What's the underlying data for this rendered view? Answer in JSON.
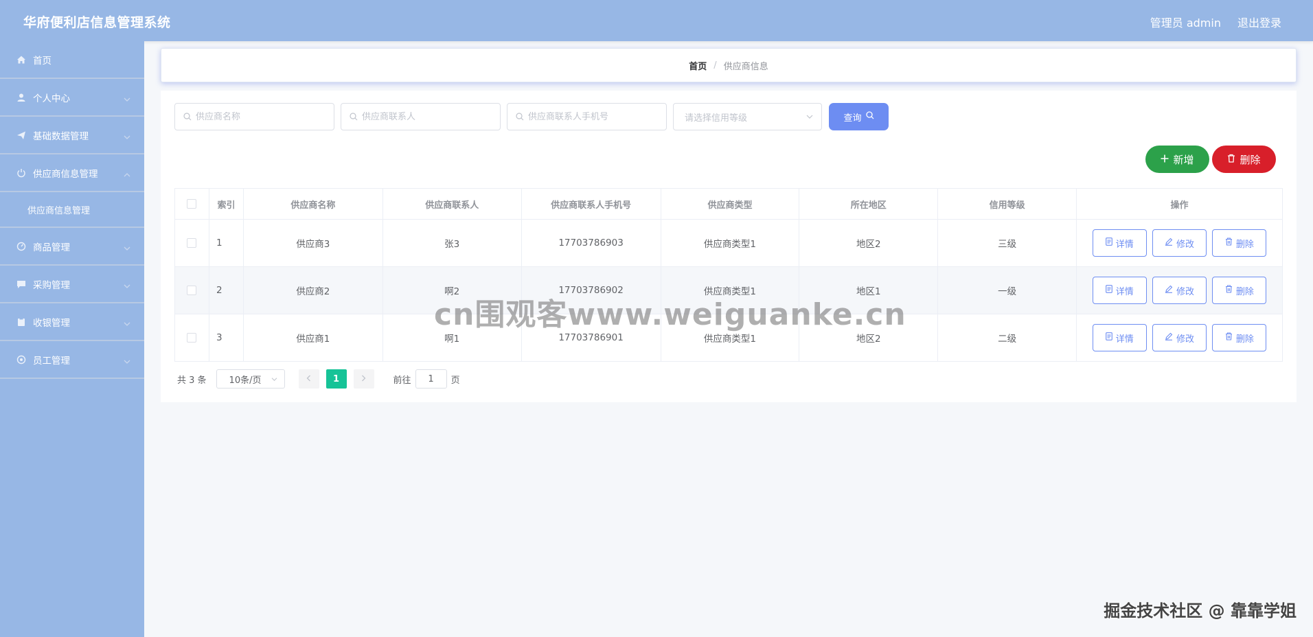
{
  "header": {
    "title": "华府便利店信息管理系统",
    "user": "管理员 admin",
    "logout": "退出登录"
  },
  "sidebar": {
    "items": [
      {
        "label": "首页",
        "icon": "home-icon"
      },
      {
        "label": "个人中心",
        "icon": "user-icon"
      },
      {
        "label": "基础数据管理",
        "icon": "send-icon"
      },
      {
        "label": "供应商信息管理",
        "icon": "power-icon"
      },
      {
        "label": "商品管理",
        "icon": "gauge-icon"
      },
      {
        "label": "采购管理",
        "icon": "message-icon"
      },
      {
        "label": "收银管理",
        "icon": "clipboard-icon"
      },
      {
        "label": "员工管理",
        "icon": "settings-icon"
      }
    ],
    "submenu": {
      "label": "供应商信息管理"
    }
  },
  "breadcrumb": {
    "home": "首页",
    "separator": "/",
    "current": "供应商信息"
  },
  "search": {
    "name_placeholder": "供应商名称",
    "contact_placeholder": "供应商联系人",
    "phone_placeholder": "供应商联系人手机号",
    "credit_placeholder": "请选择信用等级",
    "query_label": "查询"
  },
  "actions": {
    "add_label": "新增",
    "delete_label": "删除"
  },
  "table": {
    "headers": [
      "索引",
      "供应商名称",
      "供应商联系人",
      "供应商联系人手机号",
      "供应商类型",
      "所在地区",
      "信用等级",
      "操作"
    ],
    "rows": [
      {
        "index": "1",
        "name": "供应商3",
        "contact": "张3",
        "phone": "17703786903",
        "type": "供应商类型1",
        "region": "地区2",
        "credit": "三级"
      },
      {
        "index": "2",
        "name": "供应商2",
        "contact": "啊2",
        "phone": "17703786902",
        "type": "供应商类型1",
        "region": "地区1",
        "credit": "一级"
      },
      {
        "index": "3",
        "name": "供应商1",
        "contact": "啊1",
        "phone": "17703786901",
        "type": "供应商类型1",
        "region": "地区2",
        "credit": "二级"
      }
    ],
    "row_actions": {
      "detail": "详情",
      "edit": "修改",
      "delete": "删除"
    }
  },
  "pagination": {
    "total": "共 3 条",
    "page_size": "10条/页",
    "current_page": "1",
    "goto_prefix": "前往",
    "goto_value": "1",
    "goto_suffix": "页"
  },
  "watermarks": {
    "center": "cn围观客www.weiguanke.cn",
    "corner": "掘金技术社区 @ 靠靠学姐"
  },
  "colors": {
    "header_bg": "#97b7e5",
    "primary": "#6d8df2",
    "success": "#2ca14a",
    "danger": "#d81f2a",
    "page_active": "#16c397"
  }
}
